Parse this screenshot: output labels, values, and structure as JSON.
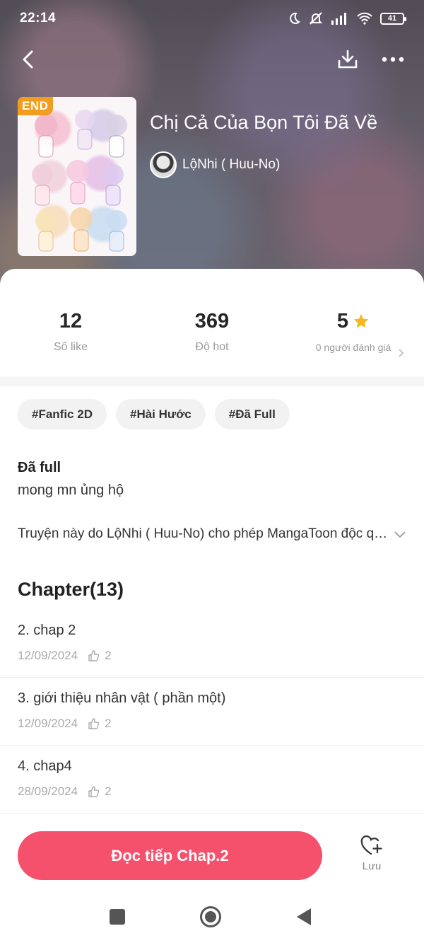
{
  "status_bar": {
    "time": "22:14",
    "battery": "41",
    "icons": [
      "moon-icon",
      "mute-icon",
      "signal-icon",
      "wifi-icon",
      "battery-icon"
    ]
  },
  "nav": {
    "back_icon": "back-arrow-icon",
    "download_icon": "download-icon",
    "more_icon": "more-icon"
  },
  "book": {
    "badge": "END",
    "title": "Chị Cả Của Bọn Tôi Đã Về",
    "author": "LộNhi ( Huu-No)"
  },
  "stats": [
    {
      "value": "12",
      "label": "Số like"
    },
    {
      "value": "369",
      "label": "Độ hot"
    },
    {
      "value": "5",
      "label": "0 người đánh giá"
    }
  ],
  "tags": [
    "#Fanfic 2D",
    "#Hài Hước",
    "#Đã Full"
  ],
  "info": {
    "status": "Đã full",
    "description": "mong mn ủng hộ",
    "permission": "Truyện này do LộNhi ( Huu-No) cho phép MangaToon độc quyền phát hành"
  },
  "chapters": {
    "heading": "Chapter(13)",
    "items": [
      {
        "title": "2. chap 2",
        "date": "12/09/2024",
        "likes": "2"
      },
      {
        "title": "3. giới thiệu nhân vật ( phần một)",
        "date": "12/09/2024",
        "likes": "2"
      },
      {
        "title": "4. chap4",
        "date": "28/09/2024",
        "likes": "2"
      }
    ]
  },
  "actions": {
    "continue_label": "Đọc tiếp Chap.2",
    "save_label": "Lưu"
  },
  "colors": {
    "accent": "#f5516c",
    "badge": "#f29d1f",
    "star": "#f5b91e"
  }
}
